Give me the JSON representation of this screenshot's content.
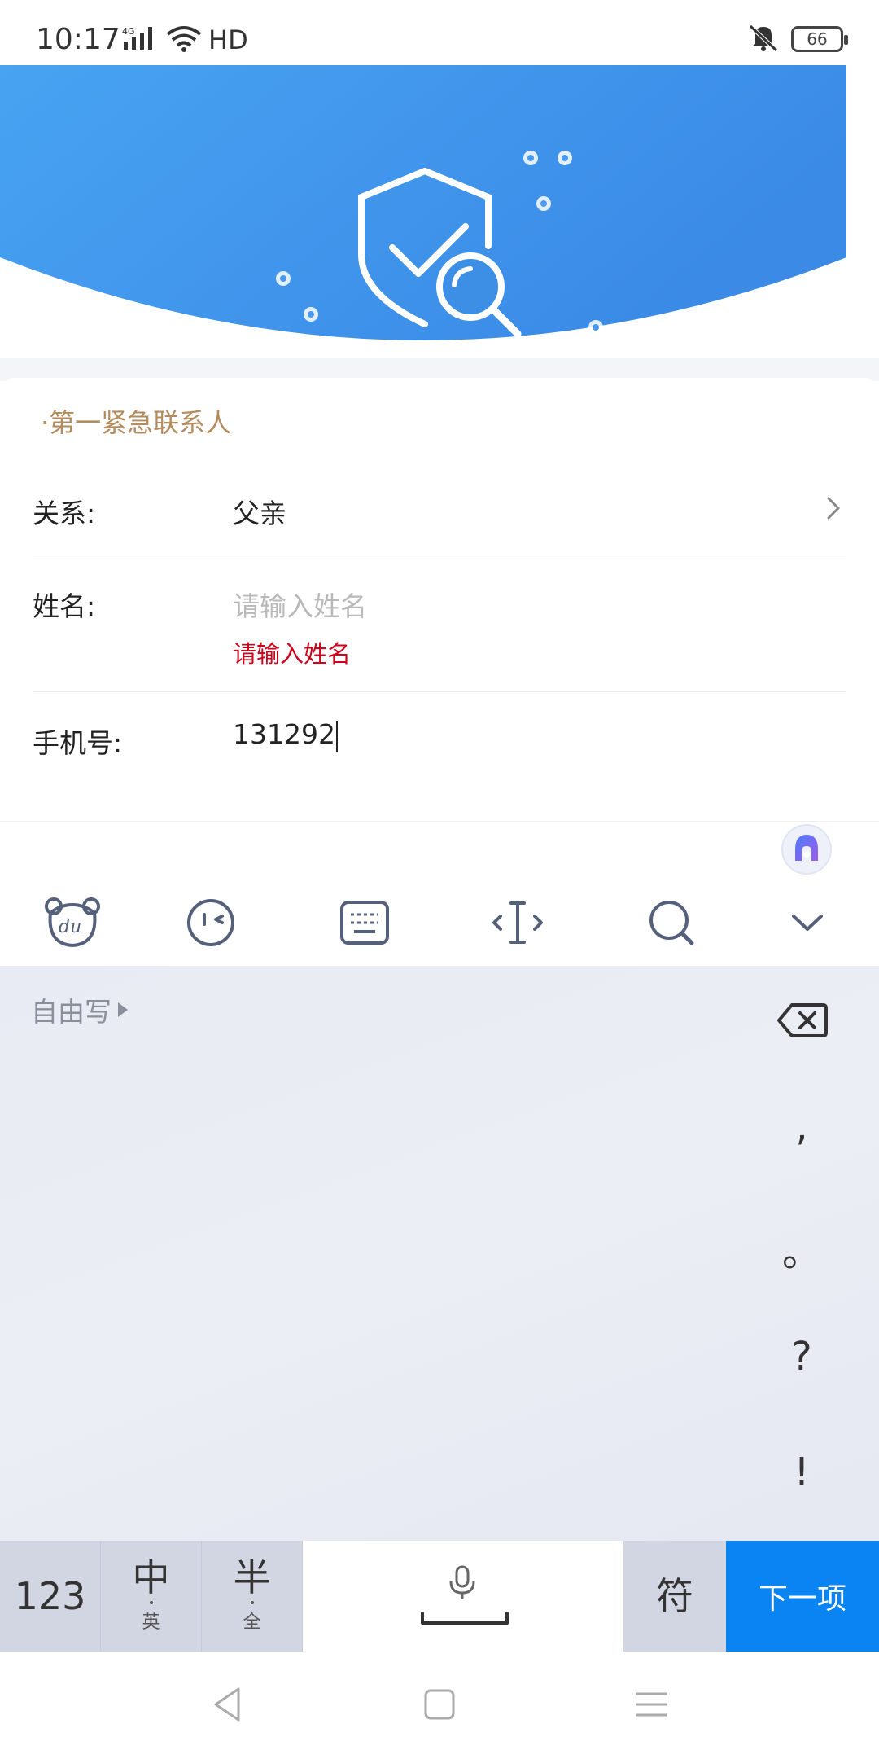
{
  "status_bar": {
    "time": "10:17",
    "network": "4G",
    "hd": "HD",
    "battery": "66"
  },
  "form": {
    "section_title": "·第一紧急联系人",
    "relation": {
      "label": "关系:",
      "value": "父亲"
    },
    "name": {
      "label": "姓名:",
      "placeholder": "请输入姓名",
      "error": "请输入姓名"
    },
    "phone": {
      "label": "手机号:",
      "value": "131292"
    }
  },
  "keyboard": {
    "free_write": "自由写",
    "punctuation": [
      ",",
      "。",
      "?",
      "!"
    ],
    "keys": {
      "num": "123",
      "zh_main": "中",
      "zh_sub": "英",
      "half_main": "半",
      "half_sub": "全",
      "symbol": "符",
      "next": "下一项"
    }
  },
  "colors": {
    "banner_blue": "#3d8fe6",
    "section_title": "#b38b5d",
    "error_red": "#d0021b",
    "next_key": "#0a84f3"
  }
}
